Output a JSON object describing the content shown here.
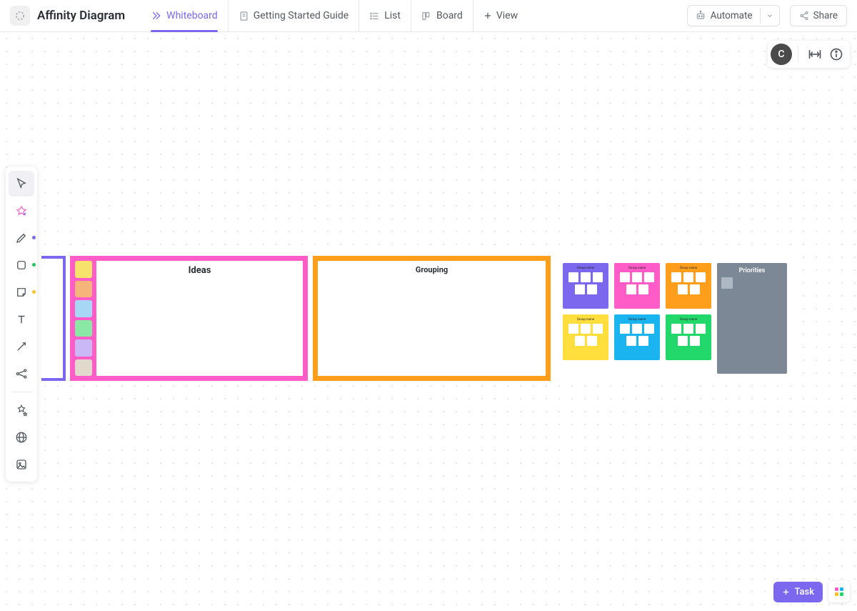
{
  "header": {
    "title": "Affinity Diagram",
    "tabs": [
      {
        "label": "Whiteboard",
        "icon": "whiteboard-icon",
        "active": true
      },
      {
        "label": "Getting Started Guide",
        "icon": "doc-icon",
        "active": false
      },
      {
        "label": "List",
        "icon": "list-icon",
        "active": false
      },
      {
        "label": "Board",
        "icon": "board-icon",
        "active": false
      }
    ],
    "add_view": "View",
    "automate": "Automate",
    "share": "Share"
  },
  "user": {
    "initial": "C"
  },
  "toolbar": {
    "tools": [
      "select",
      "generate",
      "pen",
      "shape",
      "sticky",
      "text",
      "connector",
      "network",
      "ai",
      "web",
      "image"
    ],
    "dots": {
      "pen": "#7b68ee",
      "shape": "#22c55e",
      "sticky": "#fbbf24"
    }
  },
  "canvas": {
    "ideas_label": "Ideas",
    "grouping_label": "Grouping",
    "sticky_colors": [
      "#f7e26b",
      "#f5b479",
      "#a6d8f5",
      "#8ae8a5",
      "#c9b8f5",
      "#e0d9cc"
    ],
    "groups": [
      {
        "label": "Group name",
        "color": "#7b68ee",
        "chips": 5
      },
      {
        "label": "Group name",
        "color": "#ff5cc8",
        "chips": 5
      },
      {
        "label": "Group name",
        "color": "#ff9e1b",
        "chips": 5
      },
      {
        "label": "Group name",
        "color": "#ffde3d",
        "chips": 5
      },
      {
        "label": "Group name",
        "color": "#1ab4f0",
        "chips": 5
      },
      {
        "label": "Group name",
        "color": "#22d86b",
        "chips": 5
      }
    ],
    "priorities_label": "Priorities"
  },
  "footer": {
    "task": "Task"
  }
}
